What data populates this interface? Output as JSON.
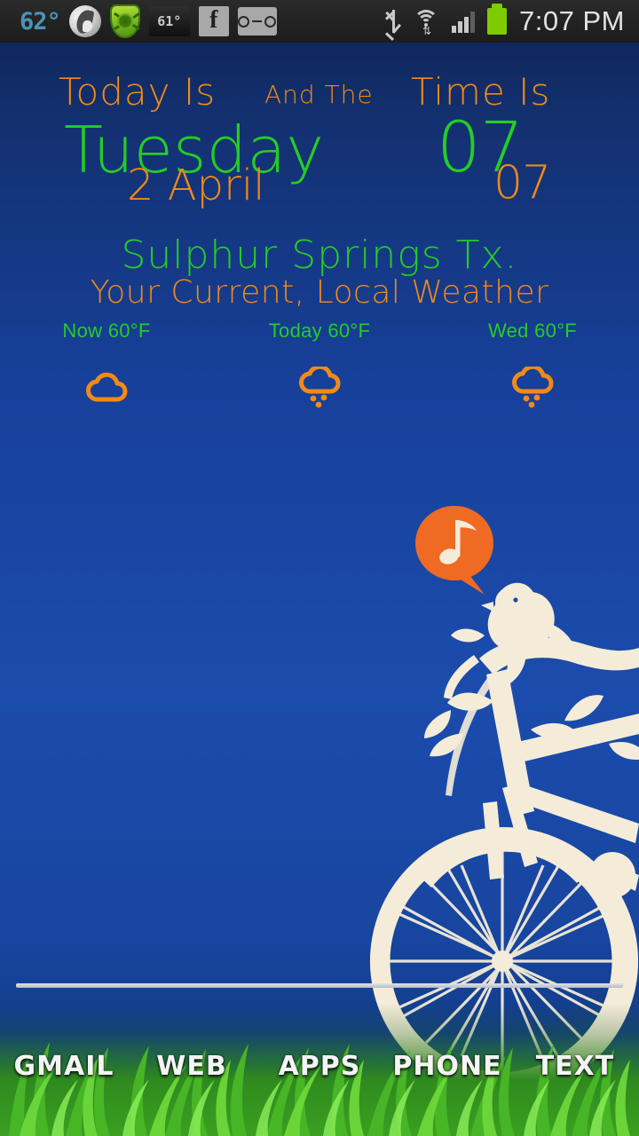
{
  "status_bar": {
    "temperature_badge": "62°",
    "notification_icons": [
      {
        "name": "swirl-logo-icon",
        "label": "swirl"
      },
      {
        "name": "drweb-shield-icon",
        "label": "shield"
      },
      {
        "name": "temperature-widget-icon",
        "label": "61°"
      },
      {
        "name": "facebook-icon",
        "label": "f"
      },
      {
        "name": "voicemail-icon",
        "label": "voicemail"
      }
    ],
    "system_icons": [
      {
        "name": "bluetooth-icon"
      },
      {
        "name": "wifi-icon"
      },
      {
        "name": "signal-icon"
      },
      {
        "name": "battery-icon"
      }
    ],
    "clock": "7:07 PM"
  },
  "widget": {
    "today_is_label": "Today Is",
    "and_the_label": "And The",
    "time_is_label": "Time Is",
    "day_name": "Tuesday",
    "date": "2 April",
    "hour": "07",
    "minute": "07",
    "city": "Sulphur Springs Tx.",
    "subtitle": "Your Current, Local Weather",
    "forecast": [
      {
        "label": "Now  60°F",
        "icon": "cloud-icon"
      },
      {
        "label": "Today  60°F",
        "icon": "rain-cloud-icon"
      },
      {
        "label": "Wed 60°F",
        "icon": "rain-cloud-icon"
      }
    ]
  },
  "artwork": {
    "music_note": "music-note-icon",
    "bird": "bird-icon",
    "bicycle": "bicycle-icon"
  },
  "dock": {
    "items": [
      {
        "label": "GMAIL"
      },
      {
        "label": "WEB"
      },
      {
        "label": "APPS"
      },
      {
        "label": "PHONE"
      },
      {
        "label": "TEXT"
      }
    ]
  },
  "colors": {
    "orange": "#f08a18",
    "green": "#25cc25",
    "cream": "#f4ecd8",
    "bubble_orange": "#ef6a23",
    "background_blue": "#1b4cad"
  }
}
